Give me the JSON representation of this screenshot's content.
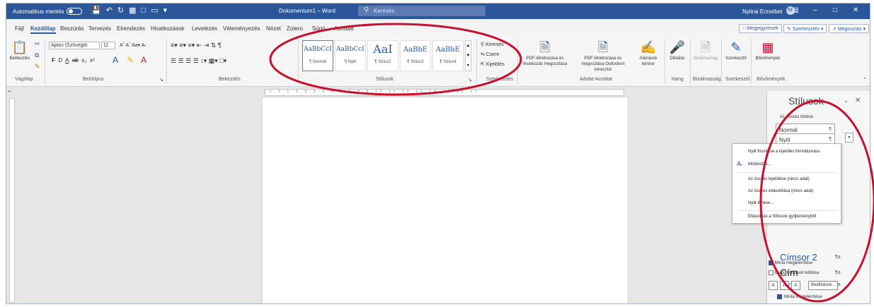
{
  "titlebar": {
    "autosave": "Automatikus mentés",
    "document_title": "Dokumentum1 – Word",
    "search_placeholder": "Keresés",
    "user": "Nyitrai Erzsébet",
    "avatar": "NE",
    "minimize": "–",
    "maximize": "□",
    "close": "✕"
  },
  "tabs": [
    "Fájl",
    "Kezdőlap",
    "Beszúrás",
    "Tervezés",
    "Elrendezés",
    "Hivatkozások",
    "Levelezés",
    "Véleményezés",
    "Nézet",
    "Zotero",
    "Súgó",
    "Acrobat"
  ],
  "tab_buttons": {
    "comments": "Megjegyzések",
    "editing": "Szerkesztés",
    "share": "Megosztás"
  },
  "ribbon": {
    "clipboard": {
      "paste": "Beillesztés",
      "label": "Vágólap"
    },
    "font": {
      "name": "Aptos (Szövegtö",
      "size": "11",
      "label": "Betűtípus"
    },
    "paragraph": {
      "label": "Bekezdés"
    },
    "styles": {
      "label": "Stílusok",
      "items": [
        {
          "sample": "AaBbCcI",
          "name": "¶ Normál"
        },
        {
          "sample": "AaBbCcI",
          "name": "¶ Nyilt"
        },
        {
          "sample": "AaI",
          "name": "¶ Stílus2"
        },
        {
          "sample": "AaBbE",
          "name": "¶ Stílus3"
        },
        {
          "sample": "AaBbE",
          "name": "¶ Stílus4"
        }
      ]
    },
    "editing": {
      "find": "Keresés",
      "replace": "Csere",
      "select": "Kijelölés",
      "label": "Szerkesztés"
    },
    "acrobat": {
      "pdf_links": "PDF létrehozása és hivatkozás megosztása",
      "pdf_outlook": "PDF létrehozása és megosztása Outlookon keresztül",
      "access": "Aláírások kérése",
      "label": "Adobe Acrobat"
    },
    "voice": {
      "dictate": "Diktálás",
      "label": "Hang"
    },
    "sensitivity": {
      "btn": "Bizalmasság",
      "label": "Bizalmasság"
    },
    "editor": {
      "btn": "Szerkesztő",
      "label": "Szerkesztő"
    },
    "addins": {
      "btn": "Bővítmények",
      "label": "Bővítmények"
    }
  },
  "styles_pane": {
    "title": "Stílusok",
    "clear_all": "Az összes törlése",
    "items": [
      {
        "label": "Normál",
        "mark": "¶"
      },
      {
        "label": "Nyilt",
        "mark": "¶"
      }
    ],
    "heading2": "Címsor 2",
    "heading2_mark": "¶a",
    "title_style": "Cím",
    "title_mark": "¶a",
    "subtitle": "Alcím",
    "subtitle_mark": "¶a",
    "show_preview": "Minta megjelenítése",
    "disable_linked": "Csatolt stílusok letiltása",
    "options": "Beállítások..."
  },
  "context_menu": {
    "items": [
      "Nyilt frissítése a kijelölés formátumára",
      "Módosítás...",
      "Az összes kijelölése (nincs adat)",
      "Az összes eltávolítása (nincs adat)",
      "Nyilt törlése...",
      "Eltávolítás a Stílusok gyűjteményből"
    ]
  },
  "annotation_color": "#c8102e"
}
